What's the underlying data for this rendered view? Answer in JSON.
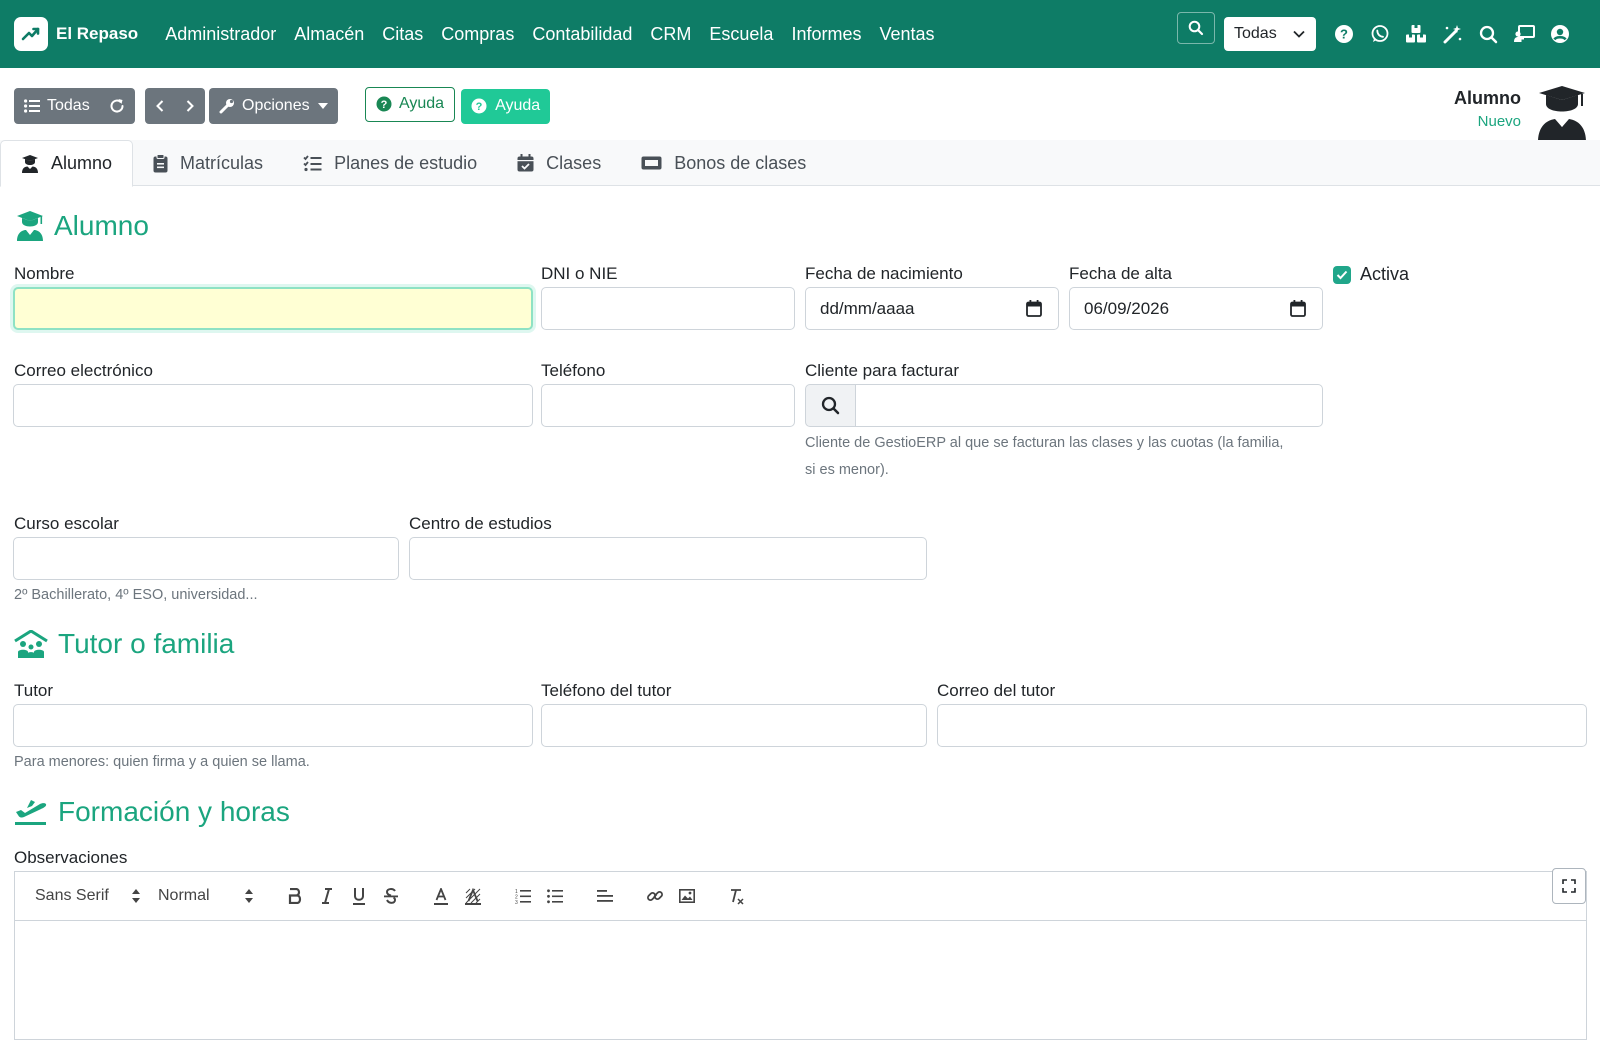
{
  "app": {
    "brand_name": "El Repaso"
  },
  "nav": {
    "menu": [
      "Administrador",
      "Almacén",
      "Citas",
      "Compras",
      "Contabilidad",
      "CRM",
      "Escuela",
      "Informes",
      "Ventas"
    ],
    "company_select": "Todas"
  },
  "toolbar": {
    "list_label": "Todas",
    "options_label": "Opciones",
    "help_outline_label": "Ayuda",
    "help_fill_label": "Ayuda"
  },
  "record": {
    "title": "Alumno",
    "status": "Nuevo"
  },
  "tabs": [
    {
      "label": "Alumno",
      "icon": "user-graduate-icon",
      "active": true
    },
    {
      "label": "Matrículas",
      "icon": "clipboard-icon"
    },
    {
      "label": "Planes de estudio",
      "icon": "tasks-icon"
    },
    {
      "label": "Clases",
      "icon": "calendar-check-icon"
    },
    {
      "label": "Bonos de clases",
      "icon": "ticket-icon"
    }
  ],
  "sections": {
    "alumno": "Alumno",
    "tutor": "Tutor o familia",
    "formacion": "Formación y horas"
  },
  "fields": {
    "nombre": {
      "label": "Nombre",
      "value": ""
    },
    "dni": {
      "label": "DNI o NIE",
      "value": ""
    },
    "fecha_nacimiento": {
      "label": "Fecha de nacimiento",
      "value": "dd/mm/aaaa"
    },
    "fecha_alta": {
      "label": "Fecha de alta",
      "value": "06/09/2026"
    },
    "activa": {
      "label": "Activa",
      "checked": true
    },
    "correo": {
      "label": "Correo electrónico",
      "value": ""
    },
    "telefono": {
      "label": "Teléfono",
      "value": ""
    },
    "cliente": {
      "label": "Cliente para facturar",
      "value": "",
      "help_line1": "Cliente de GestioERP al que se facturan las clases y las cuotas (la familia,",
      "help_line2": "si es menor)."
    },
    "curso": {
      "label": "Curso escolar",
      "value": "",
      "help": "2º Bachillerato, 4º ESO, universidad..."
    },
    "centro": {
      "label": "Centro de estudios",
      "value": ""
    },
    "tutor": {
      "label": "Tutor",
      "value": "",
      "help": "Para menores: quien firma y a quien se llama."
    },
    "telefono_tutor": {
      "label": "Teléfono del tutor",
      "value": ""
    },
    "correo_tutor": {
      "label": "Correo del tutor",
      "value": ""
    },
    "observaciones": {
      "label": "Observaciones"
    }
  },
  "editor": {
    "font": "Sans Serif",
    "size": "Normal"
  },
  "colors": {
    "navbar": "#0e7c66",
    "accent": "#1ba57f",
    "help_fill": "#20c997"
  }
}
